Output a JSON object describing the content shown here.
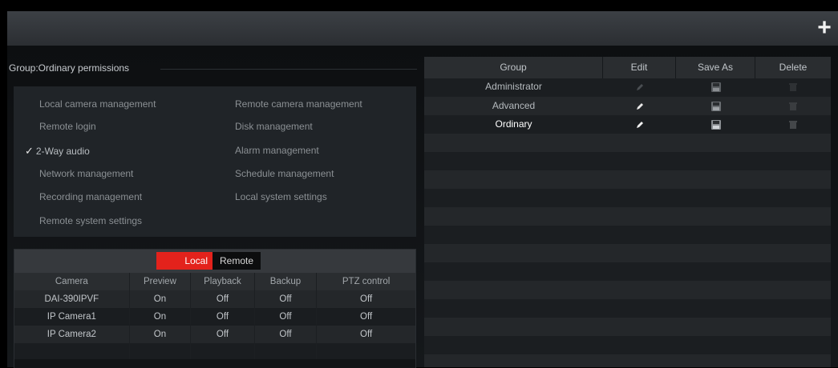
{
  "toolbar": {
    "add_symbol": "+"
  },
  "permissions": {
    "title": "Group:Ordinary permissions",
    "items": [
      {
        "label": "Local camera management",
        "checked": false
      },
      {
        "label": "Remote camera management",
        "checked": false
      },
      {
        "label": "Remote login",
        "checked": false
      },
      {
        "label": "Disk management",
        "checked": false
      },
      {
        "label": "2-Way audio",
        "checked": true
      },
      {
        "label": "Alarm management",
        "checked": false
      },
      {
        "label": "Network management",
        "checked": false
      },
      {
        "label": "Schedule management",
        "checked": false
      },
      {
        "label": "Recording management",
        "checked": false
      },
      {
        "label": "Local system settings",
        "checked": false
      },
      {
        "label": "Remote system settings",
        "checked": false
      }
    ],
    "check_symbol": "✓"
  },
  "camera_panel": {
    "tabs": {
      "local": "Local",
      "remote": "Remote",
      "active": "local"
    },
    "columns": [
      "Camera",
      "Preview",
      "Playback",
      "Backup",
      "PTZ control"
    ],
    "rows": [
      [
        "DAI-390IPVF",
        "On",
        "Off",
        "Off",
        "Off"
      ],
      [
        "IP Camera1",
        "On",
        "Off",
        "Off",
        "Off"
      ],
      [
        "IP Camera2",
        "On",
        "Off",
        "Off",
        "Off"
      ]
    ]
  },
  "groups": {
    "columns": {
      "group": "Group",
      "edit": "Edit",
      "save_as": "Save As",
      "delete": "Delete"
    },
    "rows": [
      {
        "name": "Administrator",
        "selected": false
      },
      {
        "name": "Advanced",
        "selected": false
      },
      {
        "name": "Ordinary",
        "selected": true
      }
    ],
    "icons": {
      "edit": "pencil-icon",
      "save_as": "floppy-disk-icon",
      "delete": "trash-icon"
    }
  },
  "colors": {
    "accent_red": "#e3221c",
    "background": "#000000",
    "panel": "#202428"
  }
}
